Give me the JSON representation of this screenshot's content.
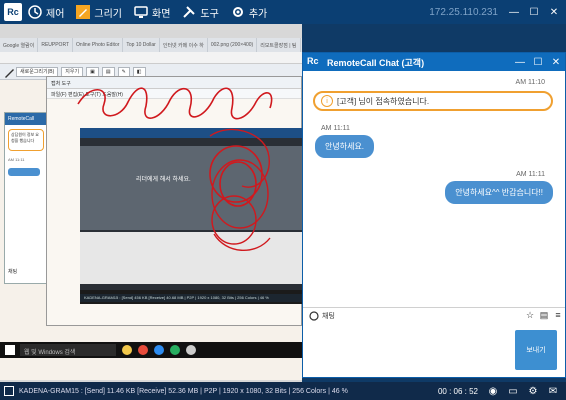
{
  "toolbar": {
    "items": [
      "제어",
      "그리기",
      "화면",
      "도구",
      "추가"
    ],
    "ip": "172.25.110.231"
  },
  "remote": {
    "tabs": [
      "Google 열람이",
      "REUPPORT",
      "Online Photo Editor",
      "Top 10 Dollar",
      "인터넷 카메 이수 하",
      "002.png (200×400)",
      "리모트콜장점 | 팀"
    ],
    "draw_tool_label": "새로운그리기(B)",
    "draw_tool_label2": "지우기",
    "paint_title": "캡처 도구",
    "paint_menu": [
      "파일(F)",
      "편집(E)",
      "도구(T)",
      "도움말(H)"
    ],
    "inner_chat_title": "RemoteCall",
    "inner_chat_msg": "상담원이 정보 요청을 했습니다",
    "inner_time": "AM 11:11",
    "inner_tab": "채팅",
    "hero_text": "리더에게 해서 하세요.",
    "inner_status": "KADENA-GRAM15 : [Send] 456 KB [Receive] 40.68 MB | P2P | 1920 x 1080, 32 Bits | 256 Colors | 46 %",
    "win_search": "웹 및 Windows 검색"
  },
  "chat": {
    "title": "RemoteCall Chat (고객)",
    "messages": [
      {
        "time": "AM 11:10",
        "text": "[고객] 님이 접속하였습니다.",
        "type": "system"
      },
      {
        "time": "AM 11:11",
        "text": "안녕하세요.",
        "type": "incoming"
      },
      {
        "time": "AM 11:11",
        "text": "안녕하세요^^ 반갑습니다!!",
        "type": "outgoing"
      }
    ],
    "tab_label": "채팅",
    "send_label": "보내기"
  },
  "status": {
    "text": "KADENA-GRAM15 : [Send] 11.46 KB  [Receive] 52.36 MB | P2P | 1920 x 1080, 32 Bits | 256 Colors | 46 %",
    "timer": "00 : 06 : 52"
  }
}
